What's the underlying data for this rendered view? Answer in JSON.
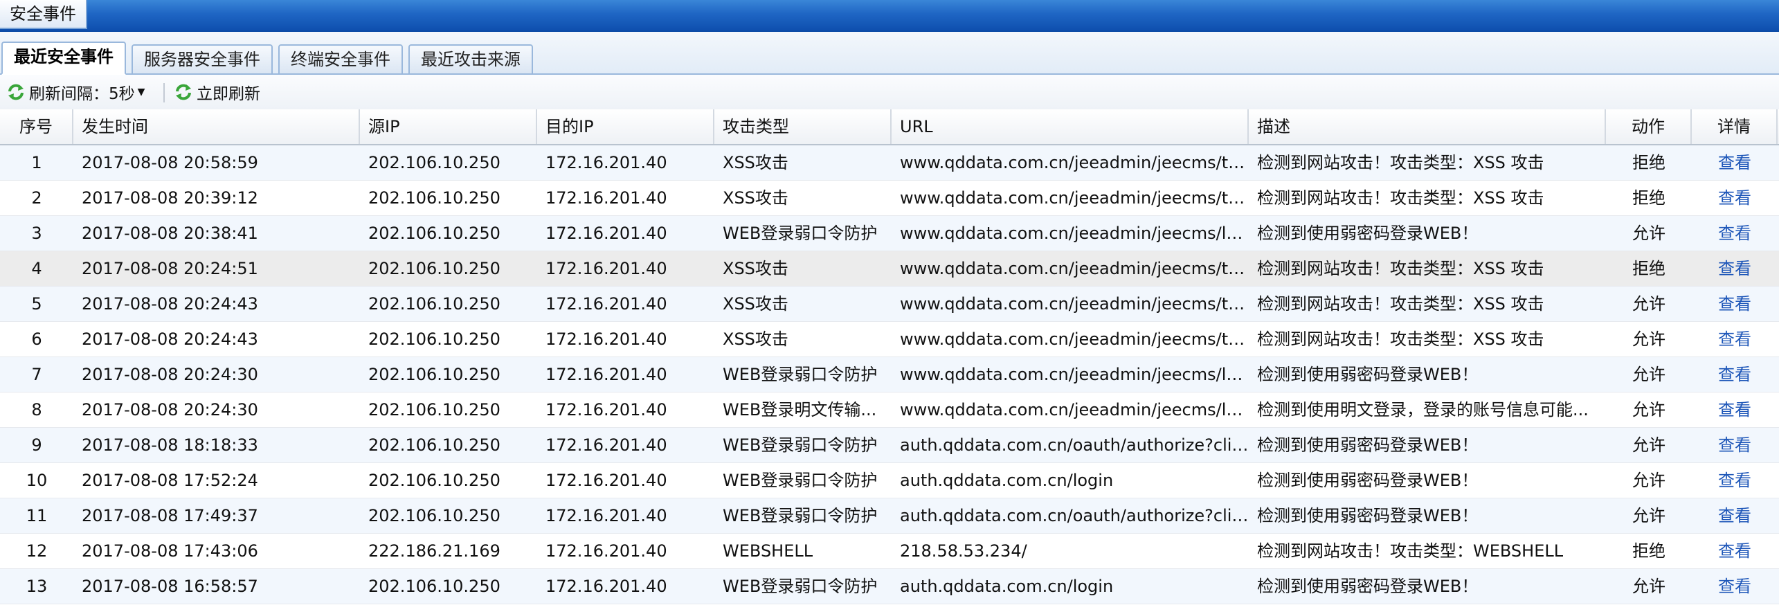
{
  "window": {
    "title": "安全事件"
  },
  "tabs": [
    {
      "label": "最近安全事件",
      "active": true
    },
    {
      "label": "服务器安全事件",
      "active": false
    },
    {
      "label": "终端安全事件",
      "active": false
    },
    {
      "label": "最近攻击来源",
      "active": false
    }
  ],
  "toolbar": {
    "refresh_interval_label": "刷新间隔：5秒",
    "refresh_now_label": "立即刷新",
    "refresh_icon": "refresh-icon",
    "accent_color": "#3aa63a"
  },
  "table": {
    "columns": [
      "序号",
      "发生时间",
      "源IP",
      "目的IP",
      "攻击类型",
      "URL",
      "描述",
      "动作",
      "详情"
    ],
    "rows": [
      {
        "no": "1",
        "time": "2017-08-08 20:58:59",
        "src": "202.106.10.250",
        "dst": "172.16.201.40",
        "type": "XSS攻击",
        "url": "www.qddata.com.cn/jeeadmin/jeecms/templ...",
        "desc": "检测到网站攻击！攻击类型：XSS 攻击",
        "action": "拒绝",
        "detail": "查看"
      },
      {
        "no": "2",
        "time": "2017-08-08 20:39:12",
        "src": "202.106.10.250",
        "dst": "172.16.201.40",
        "type": "XSS攻击",
        "url": "www.qddata.com.cn/jeeadmin/jeecms/templ...",
        "desc": "检测到网站攻击！攻击类型：XSS 攻击",
        "action": "拒绝",
        "detail": "查看"
      },
      {
        "no": "3",
        "time": "2017-08-08 20:38:41",
        "src": "202.106.10.250",
        "dst": "172.16.201.40",
        "type": "WEB登录弱口令防护",
        "url": "www.qddata.com.cn/jeeadmin/jeecms/login.do",
        "desc": "检测到使用弱密码登录WEB！",
        "action": "允许",
        "detail": "查看"
      },
      {
        "no": "4",
        "time": "2017-08-08 20:24:51",
        "src": "202.106.10.250",
        "dst": "172.16.201.40",
        "type": "XSS攻击",
        "url": "www.qddata.com.cn/jeeadmin/jeecms/templ...",
        "desc": "检测到网站攻击！攻击类型：XSS 攻击",
        "action": "拒绝",
        "detail": "查看"
      },
      {
        "no": "5",
        "time": "2017-08-08 20:24:43",
        "src": "202.106.10.250",
        "dst": "172.16.201.40",
        "type": "XSS攻击",
        "url": "www.qddata.com.cn/jeeadmin/jeecms/templ...",
        "desc": "检测到网站攻击！攻击类型：XSS 攻击",
        "action": "允许",
        "detail": "查看"
      },
      {
        "no": "6",
        "time": "2017-08-08 20:24:43",
        "src": "202.106.10.250",
        "dst": "172.16.201.40",
        "type": "XSS攻击",
        "url": "www.qddata.com.cn/jeeadmin/jeecms/templ...",
        "desc": "检测到网站攻击！攻击类型：XSS 攻击",
        "action": "允许",
        "detail": "查看"
      },
      {
        "no": "7",
        "time": "2017-08-08 20:24:30",
        "src": "202.106.10.250",
        "dst": "172.16.201.40",
        "type": "WEB登录弱口令防护",
        "url": "www.qddata.com.cn/jeeadmin/jeecms/login.do",
        "desc": "检测到使用弱密码登录WEB！",
        "action": "允许",
        "detail": "查看"
      },
      {
        "no": "8",
        "time": "2017-08-08 20:24:30",
        "src": "202.106.10.250",
        "dst": "172.16.201.40",
        "type": "WEB登录明文传输...",
        "url": "www.qddata.com.cn/jeeadmin/jeecms/login.do",
        "desc": "检测到使用明文登录，登录的账号信息可能...",
        "action": "允许",
        "detail": "查看"
      },
      {
        "no": "9",
        "time": "2017-08-08 18:18:33",
        "src": "202.106.10.250",
        "dst": "172.16.201.40",
        "type": "WEB登录弱口令防护",
        "url": "auth.qddata.com.cn/oauth/authorize?client_i...",
        "desc": "检测到使用弱密码登录WEB！",
        "action": "允许",
        "detail": "查看"
      },
      {
        "no": "10",
        "time": "2017-08-08 17:52:24",
        "src": "202.106.10.250",
        "dst": "172.16.201.40",
        "type": "WEB登录弱口令防护",
        "url": "auth.qddata.com.cn/login",
        "desc": "检测到使用弱密码登录WEB！",
        "action": "允许",
        "detail": "查看"
      },
      {
        "no": "11",
        "time": "2017-08-08 17:49:37",
        "src": "202.106.10.250",
        "dst": "172.16.201.40",
        "type": "WEB登录弱口令防护",
        "url": "auth.qddata.com.cn/oauth/authorize?client_i...",
        "desc": "检测到使用弱密码登录WEB！",
        "action": "允许",
        "detail": "查看"
      },
      {
        "no": "12",
        "time": "2017-08-08 17:43:06",
        "src": "222.186.21.169",
        "dst": "172.16.201.40",
        "type": "WEBSHELL",
        "url": "218.58.53.234/",
        "desc": "检测到网站攻击！攻击类型：WEBSHELL",
        "action": "拒绝",
        "detail": "查看"
      },
      {
        "no": "13",
        "time": "2017-08-08 16:58:57",
        "src": "202.106.10.250",
        "dst": "172.16.201.40",
        "type": "WEB登录弱口令防护",
        "url": "auth.qddata.com.cn/login",
        "desc": "检测到使用弱密码登录WEB！",
        "action": "允许",
        "detail": "查看"
      }
    ]
  }
}
